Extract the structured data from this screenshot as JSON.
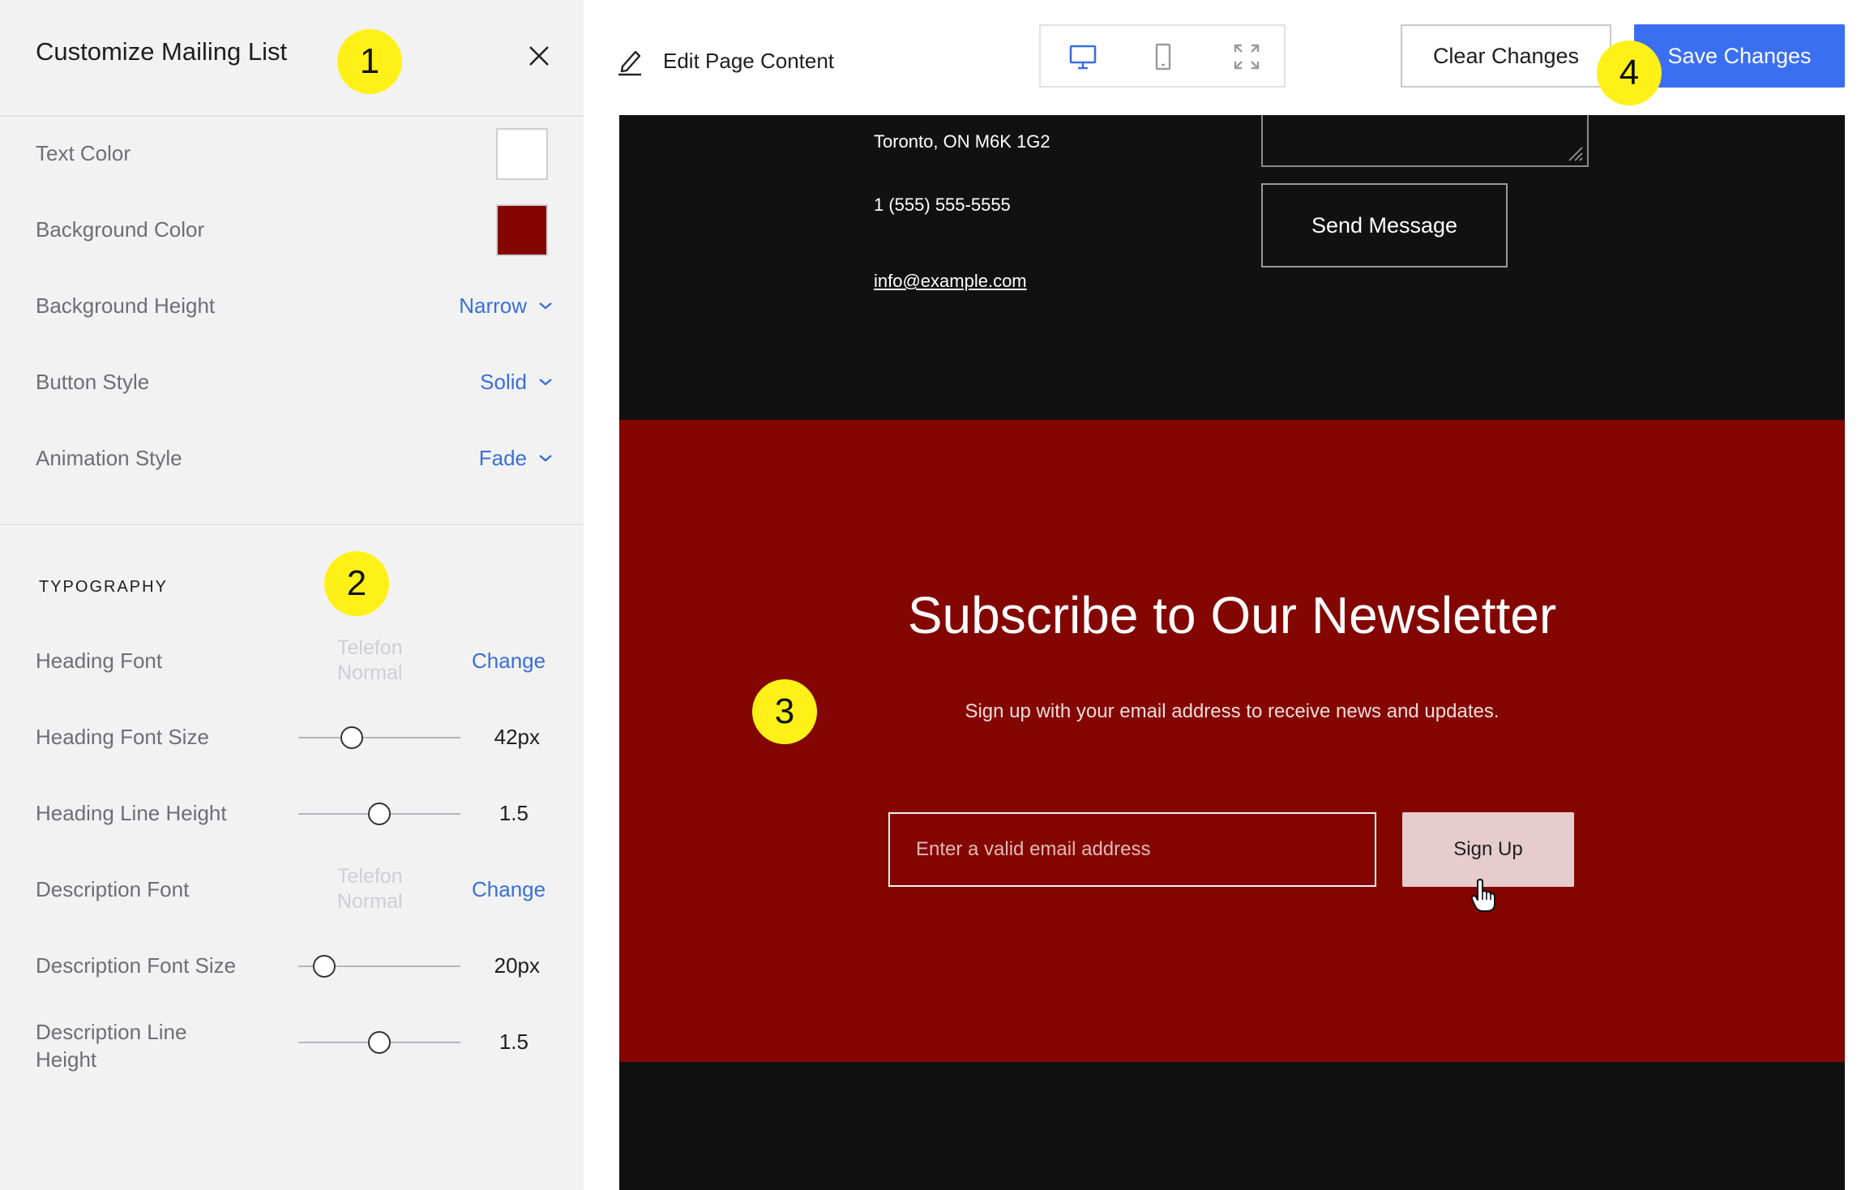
{
  "panel": {
    "title": "Customize Mailing List",
    "settings": [
      {
        "label": "Text Color"
      },
      {
        "label": "Background Color"
      },
      {
        "label": "Background Height",
        "value": "Narrow"
      },
      {
        "label": "Button Style",
        "value": "Solid"
      },
      {
        "label": "Animation Style",
        "value": "Fade"
      }
    ],
    "colors": {
      "text_color": "#ffffff",
      "background_color": "#840600"
    },
    "typography": {
      "section_title": "TYPOGRAPHY",
      "heading_font": {
        "label": "Heading Font",
        "font_line1": "Telefon",
        "font_line2": "Normal",
        "action": "Change"
      },
      "heading_font_size": {
        "label": "Heading Font Size",
        "value": "42px",
        "slider_level": 0.33
      },
      "heading_line_height": {
        "label": "Heading Line Height",
        "value": "1.5",
        "slider_level": 0.5
      },
      "description_font": {
        "label": "Description Font",
        "font_line1": "Telefon",
        "font_line2": "Normal",
        "action": "Change"
      },
      "description_font_size": {
        "label": "Description Font Size",
        "value": "20px",
        "slider_level": 0.16
      },
      "description_line_height": {
        "label_line1": "Description Line",
        "label_line2": "Height",
        "value": "1.5",
        "slider_level": 0.5
      }
    }
  },
  "topbar": {
    "edit_label": "Edit Page Content",
    "clear_label": "Clear Changes",
    "save_label": "Save Changes",
    "accent_color": "#3a6ff2"
  },
  "preview": {
    "address": "Toronto, ON M6K 1G2",
    "phone": "1 (555) 555-5555",
    "email": "info@example.com",
    "send_label": "Send Message",
    "newsletter_heading": "Subscribe to Our Newsletter",
    "newsletter_description": "Sign up with your email address to receive news and updates.",
    "email_placeholder": "Enter a valid email address",
    "signup_label": "Sign Up"
  },
  "badges": [
    "1",
    "2",
    "3",
    "4"
  ]
}
